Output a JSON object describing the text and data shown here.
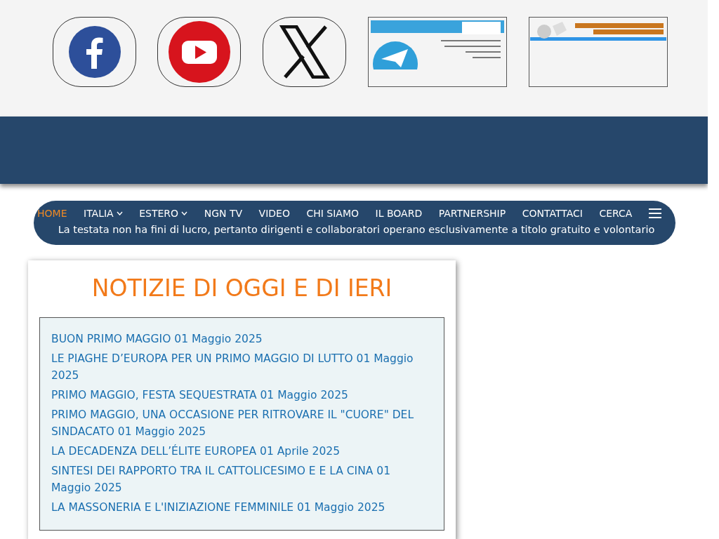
{
  "social": [
    {
      "kind": "facebook"
    },
    {
      "kind": "youtube"
    },
    {
      "kind": "x"
    }
  ],
  "banners": [
    {
      "kind": "telegram"
    },
    {
      "kind": "donation"
    }
  ],
  "nav": {
    "items": [
      {
        "label": "HOME",
        "selected": true,
        "dropdown": false
      },
      {
        "label": "ITALIA",
        "selected": false,
        "dropdown": true
      },
      {
        "label": "ESTERO",
        "selected": false,
        "dropdown": true
      },
      {
        "label": "NGN TV",
        "selected": false,
        "dropdown": false
      },
      {
        "label": "VIDEO",
        "selected": false,
        "dropdown": false
      },
      {
        "label": "CHI SIAMO",
        "selected": false,
        "dropdown": false
      },
      {
        "label": "IL BOARD",
        "selected": false,
        "dropdown": false
      },
      {
        "label": "PARTNERSHIP",
        "selected": false,
        "dropdown": false
      },
      {
        "label": "CONTATTACI",
        "selected": false,
        "dropdown": false
      },
      {
        "label": "CERCA",
        "selected": false,
        "dropdown": false
      }
    ],
    "tagline": "La testata non ha fini di lucro, pertanto dirigenti e collaboratori operano esclusivamente a titolo gratuito e volontario"
  },
  "news": {
    "title": "NOTIZIE DI OGGI E DI IERI",
    "items": [
      "BUON PRIMO MAGGIO 01 Maggio 2025",
      "LE PIAGHE D’EUROPA PER UN PRIMO MAGGIO DI LUTTO 01 Maggio 2025",
      "PRIMO MAGGIO, FESTA SEQUESTRATA 01 Maggio 2025",
      "PRIMO MAGGIO, UNA OCCASIONE PER RITROVARE IL \"CUORE\" DEL SINDACATO 01 Maggio 2025",
      "LA DECADENZA DELL’ÉLITE EUROPEA 01 Aprile 2025",
      "SINTESI DEI RAPPORTO TRA IL CATTOLICESIMO E E LA CINA 01 Maggio 2025",
      "LA MASSONERIA E L'INIZIAZIONE FEMMINILE 01 Maggio 2025"
    ]
  }
}
